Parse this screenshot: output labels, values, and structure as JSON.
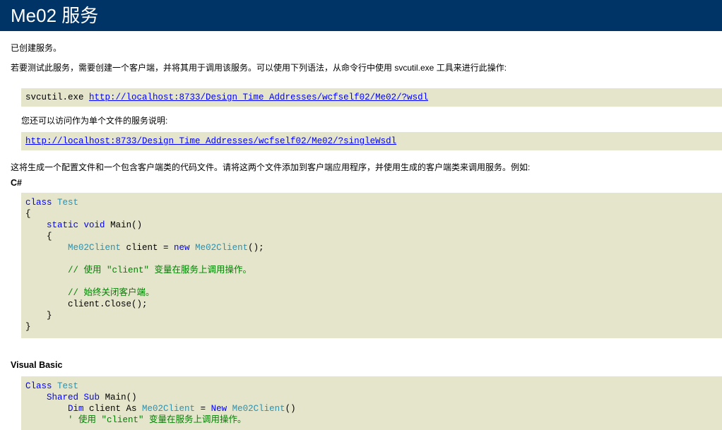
{
  "header": {
    "title": "Me02 服务"
  },
  "intro": {
    "created": "已创建服务。",
    "test_info": "若要测试此服务，需要创建一个客户端，并将其用于调用该服务。可以使用下列语法，从命令行中使用 svcutil.exe 工具来进行此操作:"
  },
  "wsdl": {
    "command": "svcutil.exe ",
    "url": "http://localhost:8733/Design_Time_Addresses/wcfself02/Me02/?wsdl"
  },
  "single": {
    "desc": "您还可以访问作为单个文件的服务说明:",
    "url": "http://localhost:8733/Design_Time_Addresses/wcfself02/Me02/?singleWsdl"
  },
  "generate_info": "这将生成一个配置文件和一个包含客户端类的代码文件。请将这两个文件添加到客户端应用程序，并使用生成的客户端类来调用服务。例如:",
  "csharp": {
    "label": "C#",
    "l1_kw": "class",
    "l1_tp": "Test",
    "l2": "{",
    "l3_kw1": "static",
    "l3_kw2": "void",
    "l3_tx": "Main()",
    "l4": "{",
    "l5_tp1": "Me02Client",
    "l5_tx1": " client = ",
    "l5_kw": "new",
    "l5_tp2": "Me02Client",
    "l5_tx2": "();",
    "l6": "// 使用 \"client\" 变量在服务上调用操作。",
    "l7": "// 始终关闭客户端。",
    "l8": "client.Close();",
    "l9": "}",
    "l10": "}"
  },
  "vb": {
    "label": "Visual Basic",
    "l1_kw": "Class",
    "l1_tp": "Test",
    "l2_kw1": "Shared",
    "l2_kw2": "Sub",
    "l2_tx": "Main()",
    "l3_kw1": "Dim",
    "l3_tx1": " client As ",
    "l3_tp1": "Me02Client",
    "l3_tx2": " = ",
    "l3_kw2": "New",
    "l3_tp2": "Me02Client",
    "l3_tx3": "()",
    "l4": "' 使用 \"client\" 变量在服务上调用操作。"
  }
}
